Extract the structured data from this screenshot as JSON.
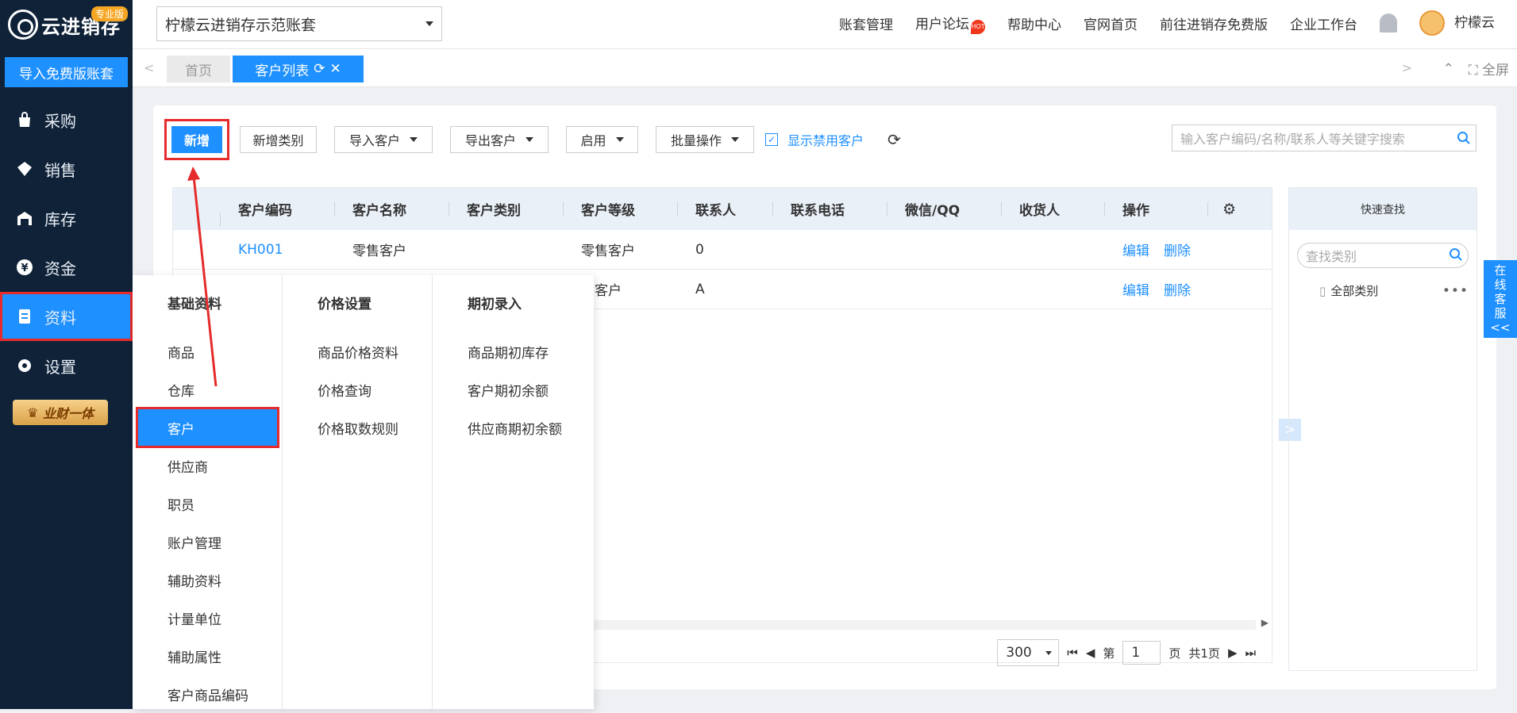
{
  "app": {
    "logo_text": "云进销存",
    "pro_badge": "专业版",
    "import_button": "导入免费版账套"
  },
  "sidebar": {
    "items": [
      {
        "label": "采购",
        "icon": "bag-icon"
      },
      {
        "label": "销售",
        "icon": "sales-icon"
      },
      {
        "label": "库存",
        "icon": "warehouse-icon"
      },
      {
        "label": "资金",
        "icon": "yen-icon"
      },
      {
        "label": "资料",
        "icon": "document-icon"
      },
      {
        "label": "设置",
        "icon": "gear-icon"
      }
    ],
    "active": "资料",
    "vip_badge": "业财一体"
  },
  "topbar": {
    "account": "柠檬云进销存示范账套",
    "links": [
      "账套管理",
      "用户论坛",
      "帮助中心",
      "官网首页",
      "前往进销存免费版",
      "企业工作台"
    ],
    "hot_label": "HOT",
    "user": "柠檬云"
  },
  "tabs": {
    "home": "首页",
    "active": "客户列表",
    "fullscreen": "全屏"
  },
  "toolbar": {
    "add": "新增",
    "add_category": "新增类别",
    "import": "导入客户",
    "export": "导出客户",
    "enable": "启用",
    "batch": "批量操作",
    "show_disabled": "显示禁用客户",
    "search_placeholder": "输入客户编码/名称/联系人等关键字搜索"
  },
  "table": {
    "columns": [
      "客户编码",
      "客户名称",
      "客户类别",
      "客户等级",
      "联系人",
      "联系电话",
      "微信/QQ",
      "收货人",
      "操作"
    ],
    "rows": [
      {
        "code": "KH001",
        "name": "零售客户",
        "category": "",
        "level": "零售客户",
        "contact": "0",
        "phone": "",
        "wechat": "",
        "receiver": "",
        "edit": "编辑",
        "delete": "删除"
      },
      {
        "code": "",
        "name": "",
        "category": "",
        "level": "售客户",
        "contact": "A",
        "phone": "",
        "wechat": "",
        "receiver": "",
        "edit": "编辑",
        "delete": "删除"
      }
    ]
  },
  "pager": {
    "page_size": "300",
    "page_prefix": "第",
    "page": "1",
    "page_suffix": "页",
    "total": "共1页"
  },
  "quick": {
    "title": "快速查找",
    "search_placeholder": "查找类别",
    "category": "全部类别"
  },
  "service": {
    "label": [
      "在",
      "线",
      "客",
      "服",
      "<<"
    ]
  },
  "flyout": {
    "col1": {
      "head": "基础资料",
      "items": [
        "商品",
        "仓库",
        "客户",
        "供应商",
        "职员",
        "账户管理",
        "辅助资料",
        "计量单位",
        "辅助属性",
        "客户商品编码"
      ],
      "active": "客户"
    },
    "col2": {
      "head": "价格设置",
      "items": [
        "商品价格资料",
        "价格查询",
        "价格取数规则"
      ]
    },
    "col3": {
      "head": "期初录入",
      "items": [
        "商品期初库存",
        "客户期初余额",
        "供应商期初余额"
      ]
    }
  },
  "colors": {
    "primary": "#1e90ff",
    "sidebar_bg": "#0f2238",
    "highlight": "#e52b2b"
  }
}
